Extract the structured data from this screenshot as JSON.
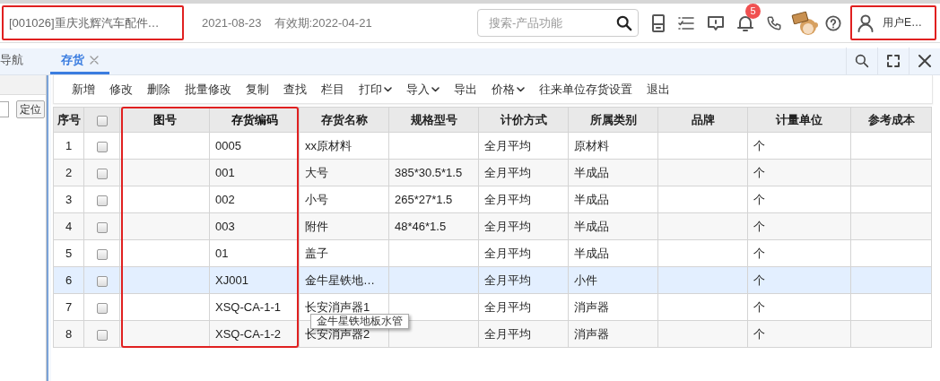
{
  "header": {
    "company": {
      "text": "[001026]重庆兆辉汽车配件…",
      "highlighted": true
    },
    "date": "2021-08-23",
    "validity": "有效期:2022-04-21",
    "search": {
      "placeholder": "搜索-产品功能"
    },
    "notification_count": "5",
    "user": {
      "name": "用户E…",
      "highlighted": true
    }
  },
  "tabs": [
    {
      "label": "导航",
      "selected": false,
      "closable": false
    },
    {
      "label": "存货",
      "selected": true,
      "closable": true
    }
  ],
  "sidebar": {
    "locate_button": "定位"
  },
  "toolbar": [
    {
      "label": "新增",
      "dropdown": false
    },
    {
      "label": "修改",
      "dropdown": false
    },
    {
      "label": "删除",
      "dropdown": false
    },
    {
      "label": "批量修改",
      "dropdown": false
    },
    {
      "label": "复制",
      "dropdown": false
    },
    {
      "label": "查找",
      "dropdown": false
    },
    {
      "label": "栏目",
      "dropdown": false
    },
    {
      "label": "打印",
      "dropdown": true
    },
    {
      "label": "导入",
      "dropdown": true
    },
    {
      "label": "导出",
      "dropdown": false
    },
    {
      "label": "价格",
      "dropdown": true
    },
    {
      "label": "往来单位存货设置",
      "dropdown": false
    },
    {
      "label": "退出",
      "dropdown": false
    }
  ],
  "table": {
    "index_label": "序号",
    "header_checked": false,
    "columns": [
      {
        "kind": "text",
        "label": "图号",
        "highlighted": true
      },
      {
        "kind": "text",
        "label": "存货编码",
        "highlighted": true
      },
      {
        "kind": "text",
        "label": "存货名称",
        "highlighted": false
      },
      {
        "kind": "text",
        "label": "规格型号",
        "highlighted": false
      },
      {
        "kind": "text",
        "label": "计价方式",
        "highlighted": false
      },
      {
        "kind": "text",
        "label": "所属类别",
        "highlighted": false
      },
      {
        "kind": "text",
        "label": "品牌",
        "highlighted": false
      },
      {
        "kind": "text",
        "label": "计量单位",
        "highlighted": false
      },
      {
        "kind": "text",
        "label": "参考成本",
        "highlighted": false
      }
    ],
    "rows": [
      {
        "index": "1",
        "checked": false,
        "selected": false,
        "cells": [
          "",
          "0005",
          "xx原材料",
          "",
          "全月平均",
          "原材料",
          "",
          "个",
          ""
        ]
      },
      {
        "index": "2",
        "checked": false,
        "selected": false,
        "cells": [
          "",
          "001",
          "大号",
          "385*30.5*1.5",
          "全月平均",
          "半成品",
          "",
          "个",
          ""
        ]
      },
      {
        "index": "3",
        "checked": false,
        "selected": false,
        "cells": [
          "",
          "002",
          "小号",
          "265*27*1.5",
          "全月平均",
          "半成品",
          "",
          "个",
          ""
        ]
      },
      {
        "index": "4",
        "checked": false,
        "selected": false,
        "cells": [
          "",
          "003",
          "附件",
          "48*46*1.5",
          "全月平均",
          "半成品",
          "",
          "个",
          ""
        ]
      },
      {
        "index": "5",
        "checked": false,
        "selected": false,
        "cells": [
          "",
          "01",
          "盖子",
          "",
          "全月平均",
          "半成品",
          "",
          "个",
          ""
        ]
      },
      {
        "index": "6",
        "checked": false,
        "selected": true,
        "cells": [
          "",
          "XJ001",
          "金牛星铁地…",
          "",
          "全月平均",
          "小件",
          "",
          "个",
          ""
        ]
      },
      {
        "index": "7",
        "checked": false,
        "selected": false,
        "cells": [
          "",
          "XSQ-CA-1-1",
          "长安消声器1",
          "",
          "全月平均",
          "消声器",
          "",
          "个",
          ""
        ]
      },
      {
        "index": "8",
        "checked": false,
        "selected": false,
        "cells": [
          "",
          "XSQ-CA-1-2",
          "长安消声器2",
          "",
          "全月平均",
          "消声器",
          "",
          "个",
          ""
        ]
      }
    ],
    "tooltip": "金牛星铁地板水管"
  }
}
